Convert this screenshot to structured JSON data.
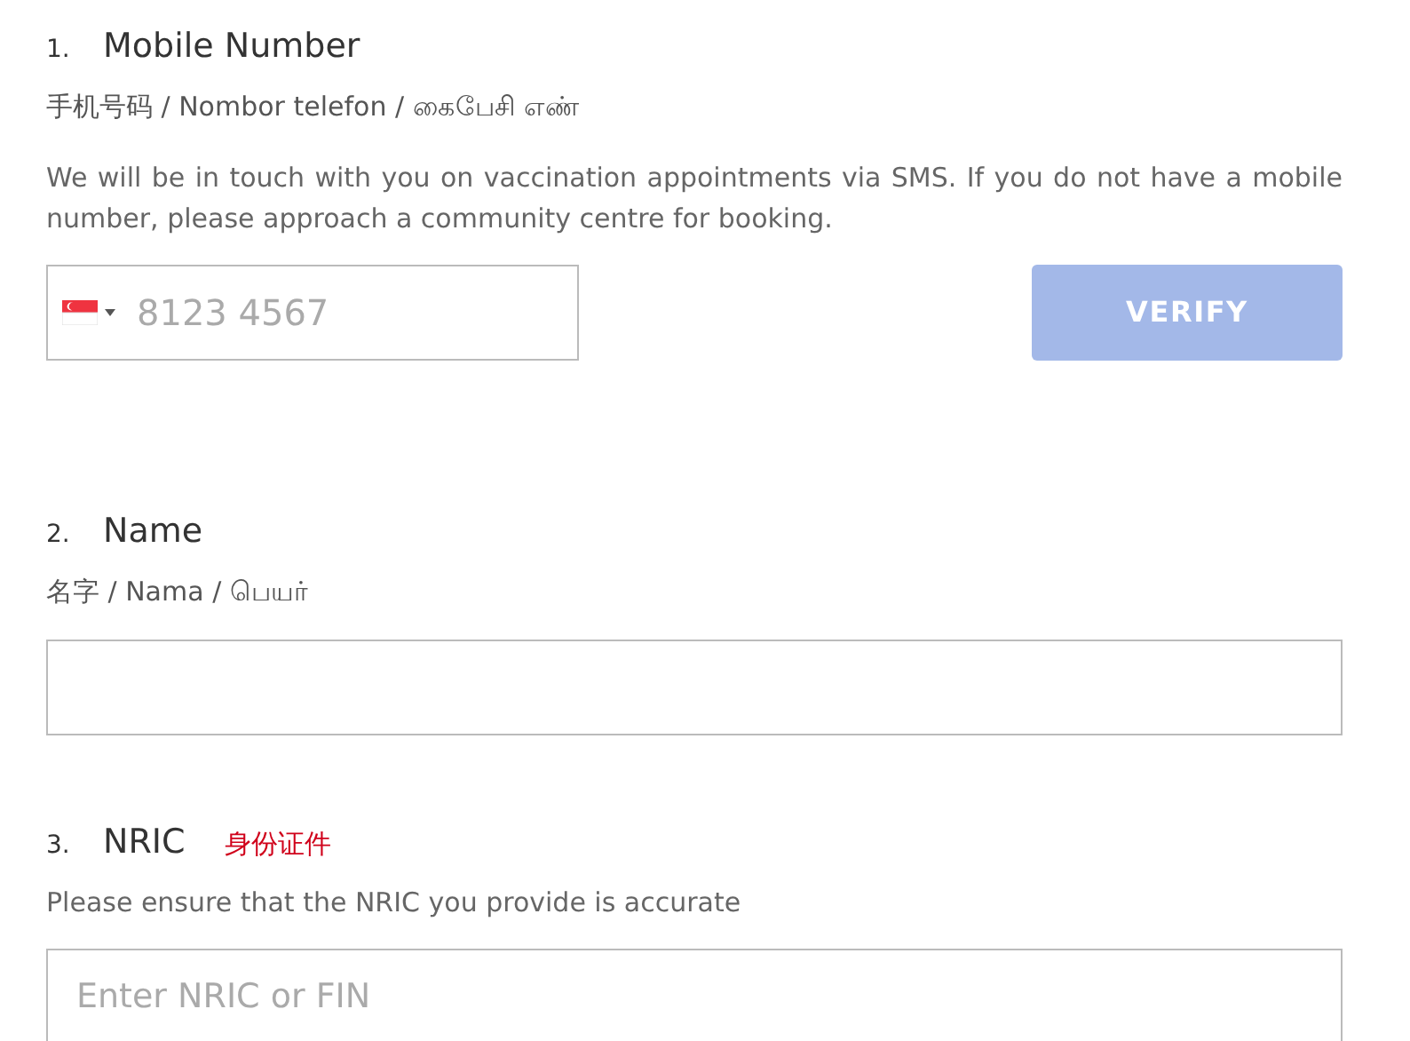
{
  "fields": [
    {
      "kind": "phone",
      "number": "1.",
      "label": "Mobile Number",
      "translations": "手机号码 / Nombor telefon / கைபேசி எண்",
      "description": "We will be in touch with you on vaccination appointments via SMS. If you do not have a mobile number, please approach a community centre for booking.",
      "placeholder": "8123 4567",
      "button": {
        "label": "VERIFY",
        "disabled": true
      }
    },
    {
      "kind": "text",
      "number": "2.",
      "label": "Name",
      "translations": "名字 / Nama / பெயர்"
    },
    {
      "kind": "text",
      "number": "3.",
      "label": "NRIC",
      "note": "身份证件",
      "description": "Please ensure that the NRIC you provide is accurate",
      "placeholder": "Enter NRIC or FIN"
    }
  ]
}
